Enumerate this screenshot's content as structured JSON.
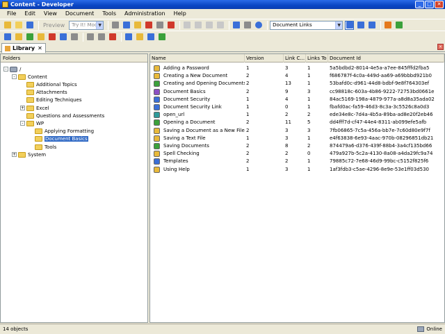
{
  "window": {
    "title": "Content - Developer",
    "controls": [
      "_",
      "□",
      "✕"
    ]
  },
  "menu": [
    "File",
    "Edit",
    "View",
    "Document",
    "Tools",
    "Administration",
    "Help"
  ],
  "toolbar": {
    "preview_label": "Preview",
    "mode_value": "Try It! Mode",
    "view_value": "Document Links",
    "tb1_icons": [
      "new-document-icon",
      "open-folder-icon",
      "save-icon",
      "preview-icon",
      "cut-icon",
      "copy-icon",
      "paste-icon",
      "delete-icon",
      "properties-icon",
      "check-in-icon",
      "undo-icon",
      "redo-icon",
      "collapse-icon",
      "expand-icon",
      "find-icon",
      "filter-icon",
      "help-icon"
    ],
    "tb2_icons": [
      "publish-icon",
      "generate-icon",
      "import-icon",
      "export-icon",
      "package-icon",
      "record-icon",
      "layout-icon",
      "insert-icon",
      "move-up-icon",
      "outline-icon",
      "tree-icon",
      "format-icon",
      "link-icon",
      "check-icon",
      "split-view-icon",
      "details-view-icon",
      "columns-view-icon",
      "new-window-icon",
      "refresh-icon"
    ],
    "colors": {
      "blue": "#3a6fd8",
      "green": "#3ba13b",
      "yellow": "#e8b93a",
      "red": "#d0392b",
      "purple": "#8b4fc3",
      "gray": "#8c8c8c",
      "orange": "#e47a1c",
      "teal": "#2e9a9a"
    }
  },
  "tab": {
    "label": "Library",
    "close": "✕"
  },
  "folders_pane": {
    "header": "Folders",
    "root": "/",
    "items": [
      {
        "label": "Content",
        "level": 1,
        "expander": "-"
      },
      {
        "label": "Additional Topics",
        "level": 2,
        "expander": ""
      },
      {
        "label": "Attachments",
        "level": 2,
        "expander": ""
      },
      {
        "label": "Editing Techniques",
        "level": 2,
        "expander": ""
      },
      {
        "label": "Excel",
        "level": 2,
        "expander": "+"
      },
      {
        "label": "Questions and Assessments",
        "level": 2,
        "expander": ""
      },
      {
        "label": "WP",
        "level": 2,
        "expander": "-"
      },
      {
        "label": "Applying Formatting",
        "level": 3,
        "expander": ""
      },
      {
        "label": "Document Basics",
        "level": 3,
        "expander": "",
        "selected": true
      },
      {
        "label": "Tools",
        "level": 3,
        "expander": ""
      },
      {
        "label": "System",
        "level": 1,
        "expander": "+"
      }
    ]
  },
  "list": {
    "columns": [
      "Name",
      "Version",
      "Link C...",
      "Links To",
      "Document Id"
    ],
    "rows": [
      {
        "name": "Adding a Password",
        "version": "1",
        "linkc": "3",
        "links": "1",
        "id": "5a5bdbd2-8014-4e5a-a7ee-845fffd2fba5",
        "icon": "topic-icon",
        "color": "#e8b93a"
      },
      {
        "name": "Creating a New Document",
        "version": "2",
        "linkc": "4",
        "links": "1",
        "id": "f686787f-4c0a-449d-aa69-a69bbbd921b0",
        "icon": "topic-icon",
        "color": "#e8b93a"
      },
      {
        "name": "Creating and Opening Documents",
        "version": "2",
        "linkc": "13",
        "links": "1",
        "id": "53bafd0c-d961-44d8-bdbf-9e8f764303ef",
        "icon": "module-icon",
        "color": "#3ba13b"
      },
      {
        "name": "Document Basics",
        "version": "2",
        "linkc": "9",
        "links": "3",
        "id": "cc98818c-603a-4b86-9222-72753bd0661e",
        "icon": "book-icon",
        "color": "#8b4fc3"
      },
      {
        "name": "Document Security",
        "version": "1",
        "linkc": "4",
        "links": "1",
        "id": "84ac5169-198a-4879-977a-a8d8a35ada02",
        "icon": "section-icon",
        "color": "#3a6fd8"
      },
      {
        "name": "Document Security Link",
        "version": "1",
        "linkc": "0",
        "links": "1",
        "id": "fbafd0ac-fa59-46d3-8c3a-3c5526c8a0d3",
        "icon": "link-icon",
        "color": "#3a6fd8"
      },
      {
        "name": "open_url",
        "version": "1",
        "linkc": "2",
        "links": "2",
        "id": "ede34e8c-7d4a-4b5a-89ba-ad8e20f2eb46",
        "icon": "web-page-icon",
        "color": "#2e9a9a"
      },
      {
        "name": "Opening a Document",
        "version": "2",
        "linkc": "11",
        "links": "5",
        "id": "dd4fff7d-cf47-44e4-8311-ab099efe5afb",
        "icon": "module-icon",
        "color": "#3ba13b"
      },
      {
        "name": "Saving a Document as a New File",
        "version": "2",
        "linkc": "3",
        "links": "3",
        "id": "7fb06865-7c5a-456a-bb7e-7c60d80e9f7f",
        "icon": "topic-icon",
        "color": "#e8b93a"
      },
      {
        "name": "Saving a Text File",
        "version": "1",
        "linkc": "3",
        "links": "1",
        "id": "e4f63838-6e93-4aac-970b-08296851db21",
        "icon": "topic-icon",
        "color": "#e8b93a"
      },
      {
        "name": "Saving Documents",
        "version": "2",
        "linkc": "8",
        "links": "2",
        "id": "874479a6-d376-439f-88b4-3a4cf135bd66",
        "icon": "module-icon",
        "color": "#3ba13b"
      },
      {
        "name": "Spell Checking",
        "version": "2",
        "linkc": "2",
        "links": "0",
        "id": "479a927b-5c2a-4130-8a08-a4da29fc9a74",
        "icon": "topic-icon",
        "color": "#e8b93a"
      },
      {
        "name": "Templates",
        "version": "2",
        "linkc": "2",
        "links": "1",
        "id": "79885c72-7e68-46d9-99bc-c5152f825f6",
        "icon": "section-icon",
        "color": "#3a6fd8"
      },
      {
        "name": "Using Help",
        "version": "1",
        "linkc": "3",
        "links": "1",
        "id": "1af3fdb3-c5ae-4296-8e9e-53e1ff03d530",
        "icon": "topic-icon",
        "color": "#e8b93a"
      }
    ]
  },
  "status": {
    "count": "14 objects",
    "state": "Online"
  }
}
